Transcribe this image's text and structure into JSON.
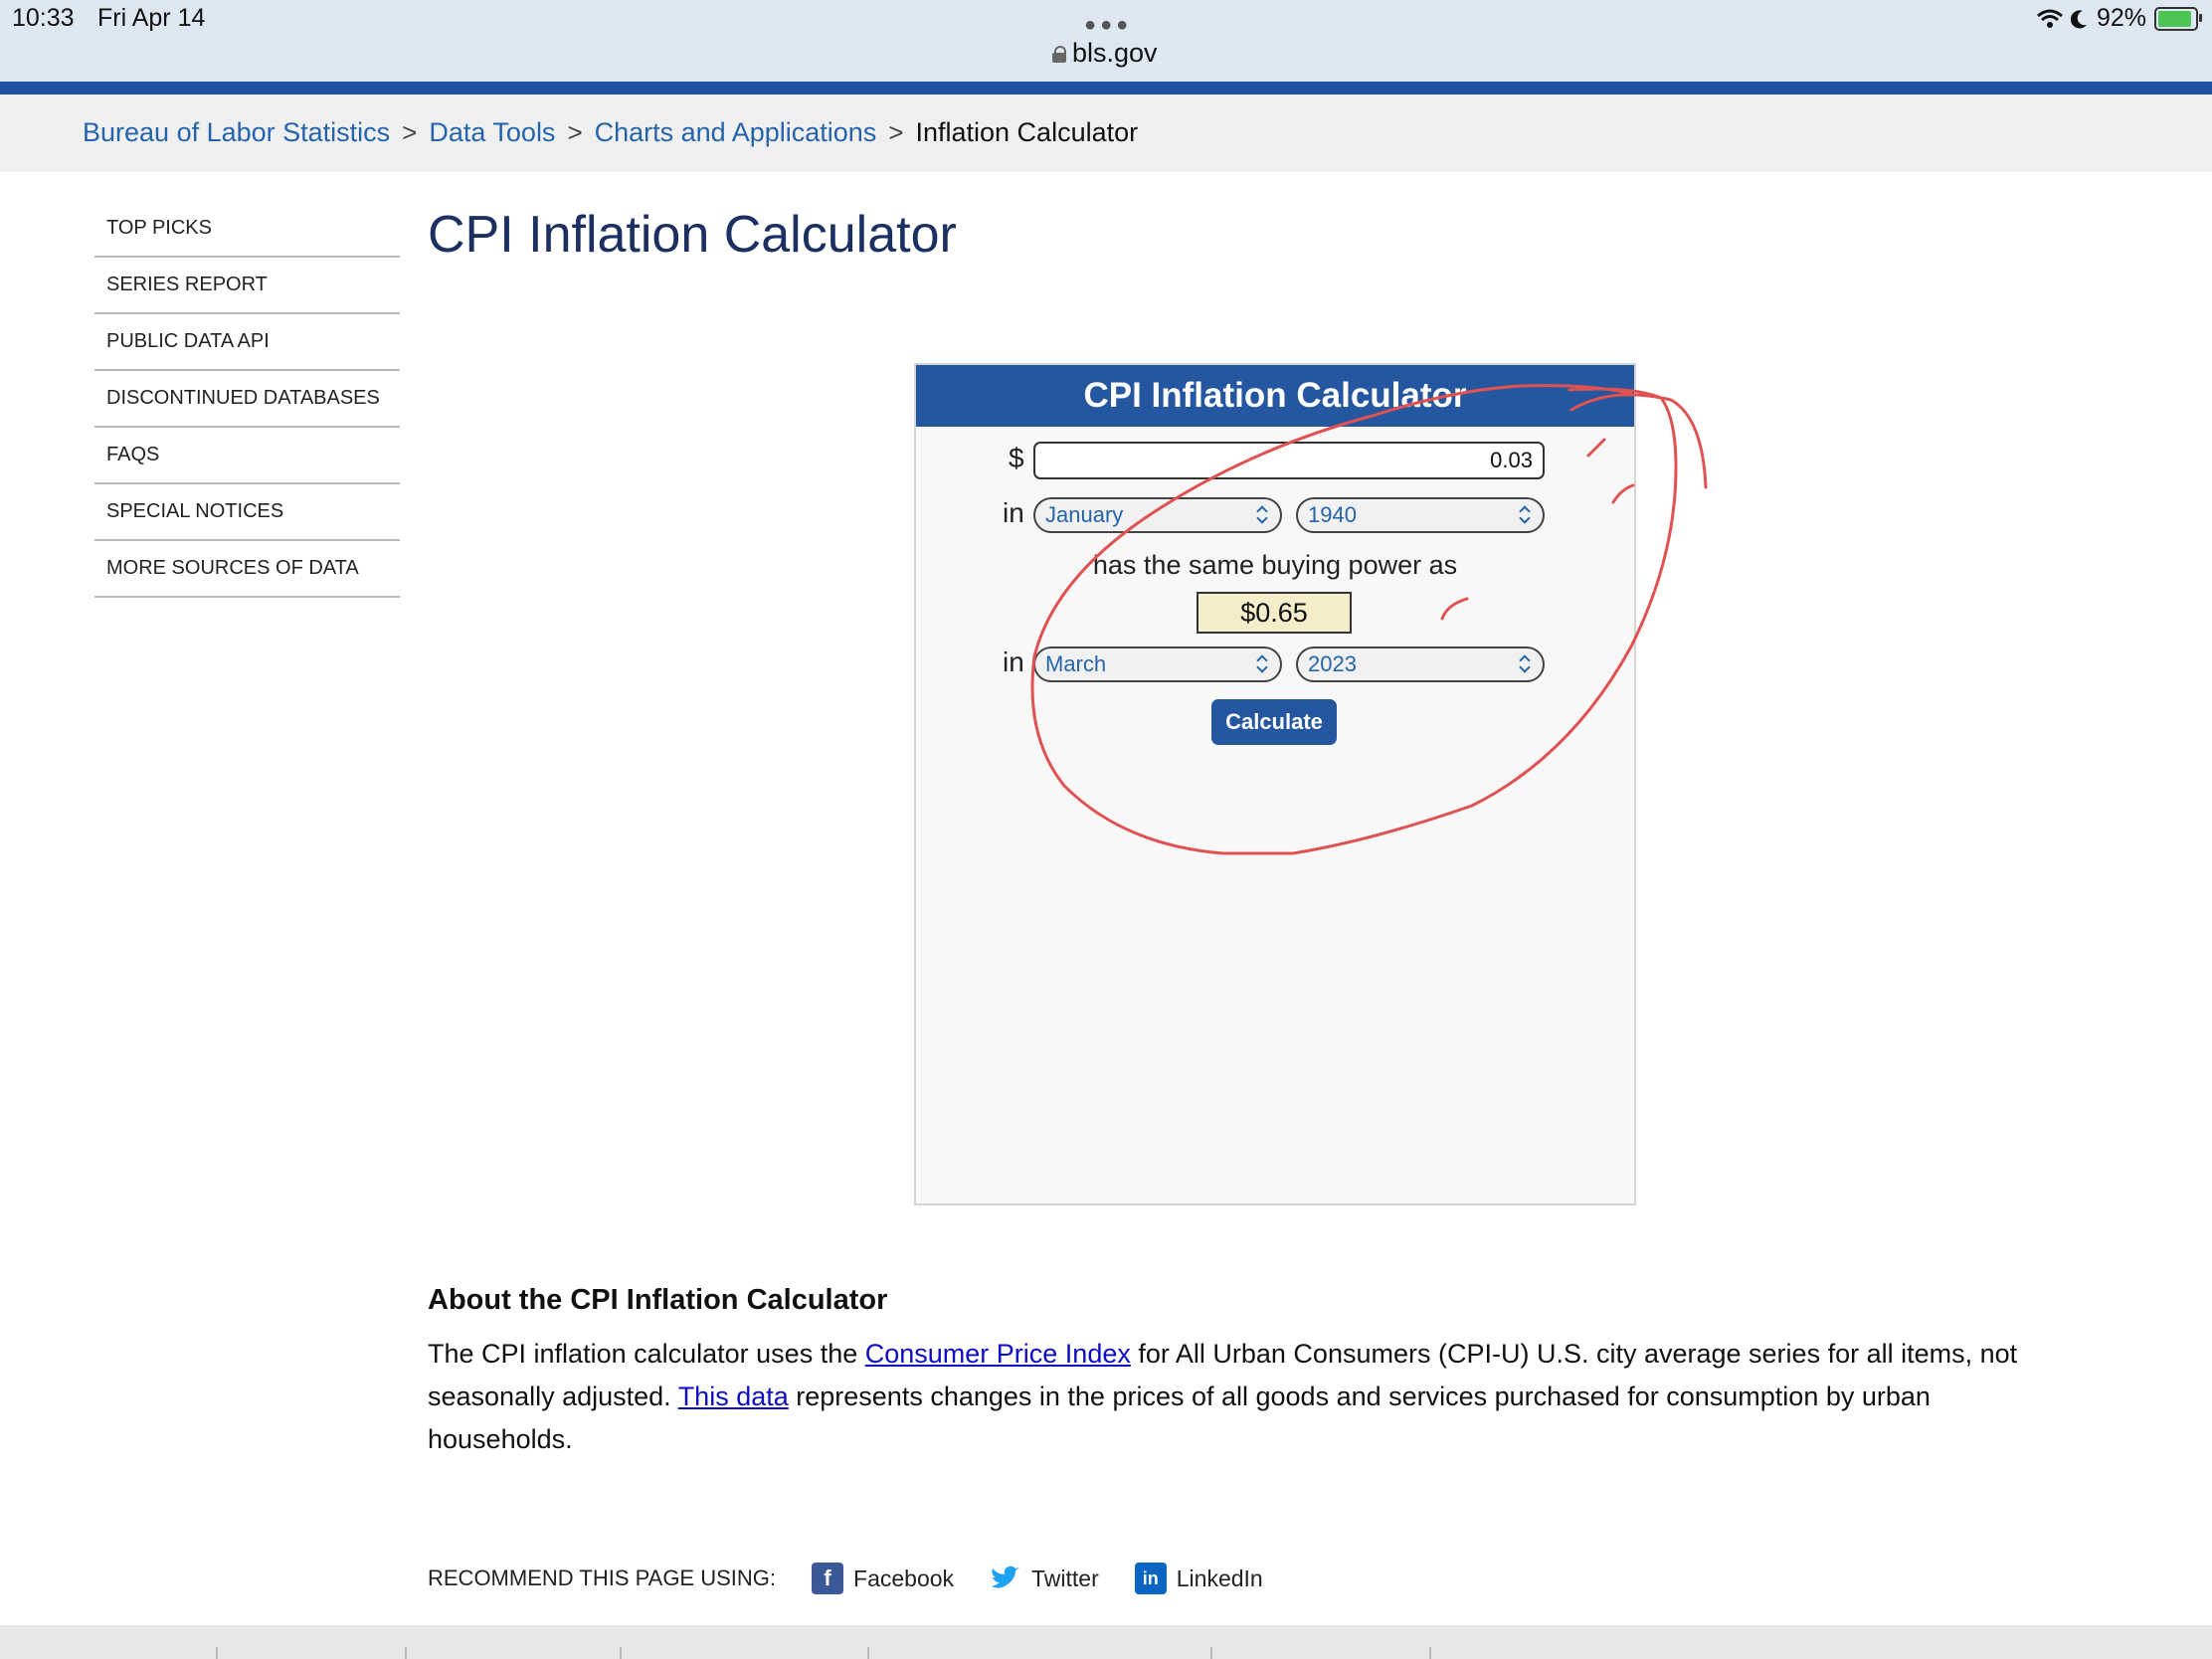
{
  "status_bar": {
    "time": "10:33",
    "date": "Fri Apr 14",
    "battery": "92%"
  },
  "browser": {
    "url": "bls.gov"
  },
  "breadcrumb": [
    {
      "label": "Bureau of Labor Statistics"
    },
    {
      "label": "Data Tools"
    },
    {
      "label": "Charts and Applications"
    },
    {
      "label": "Inflation Calculator"
    }
  ],
  "sidebar": {
    "items": [
      {
        "label": "TOP PICKS"
      },
      {
        "label": "SERIES REPORT"
      },
      {
        "label": "PUBLIC DATA API"
      },
      {
        "label": "DISCONTINUED DATABASES"
      },
      {
        "label": "FAQS"
      },
      {
        "label": "SPECIAL NOTICES"
      },
      {
        "label": "MORE SOURCES OF DATA"
      }
    ]
  },
  "page": {
    "title": "CPI Inflation Calculator"
  },
  "calculator": {
    "header": "CPI Inflation Calculator",
    "currency_symbol": "$",
    "amount": "0.03",
    "in_label": "in",
    "from_month": "January",
    "from_year": "1940",
    "same_power_text": "has the same buying power as",
    "result": "$0.65",
    "to_month": "March",
    "to_year": "2023",
    "button": "Calculate"
  },
  "about": {
    "title": "About the CPI Inflation Calculator",
    "text_1": "The CPI inflation calculator uses the ",
    "link_1": "Consumer Price Index",
    "text_2": " for All Urban Consumers (CPI-U) U.S. city average series for all items, not seasonally adjusted. ",
    "link_2": "This data",
    "text_3": " represents changes in the prices of all goods and services purchased for consumption by urban households."
  },
  "recommend": {
    "label": "RECOMMEND THIS PAGE USING:",
    "facebook": "Facebook",
    "twitter": "Twitter",
    "linkedin": "LinkedIn"
  },
  "colors": {
    "header_blue": "#24579f",
    "link_blue": "#2464ad",
    "annotation_red": "#e05252",
    "result_bg": "#f6edca"
  }
}
